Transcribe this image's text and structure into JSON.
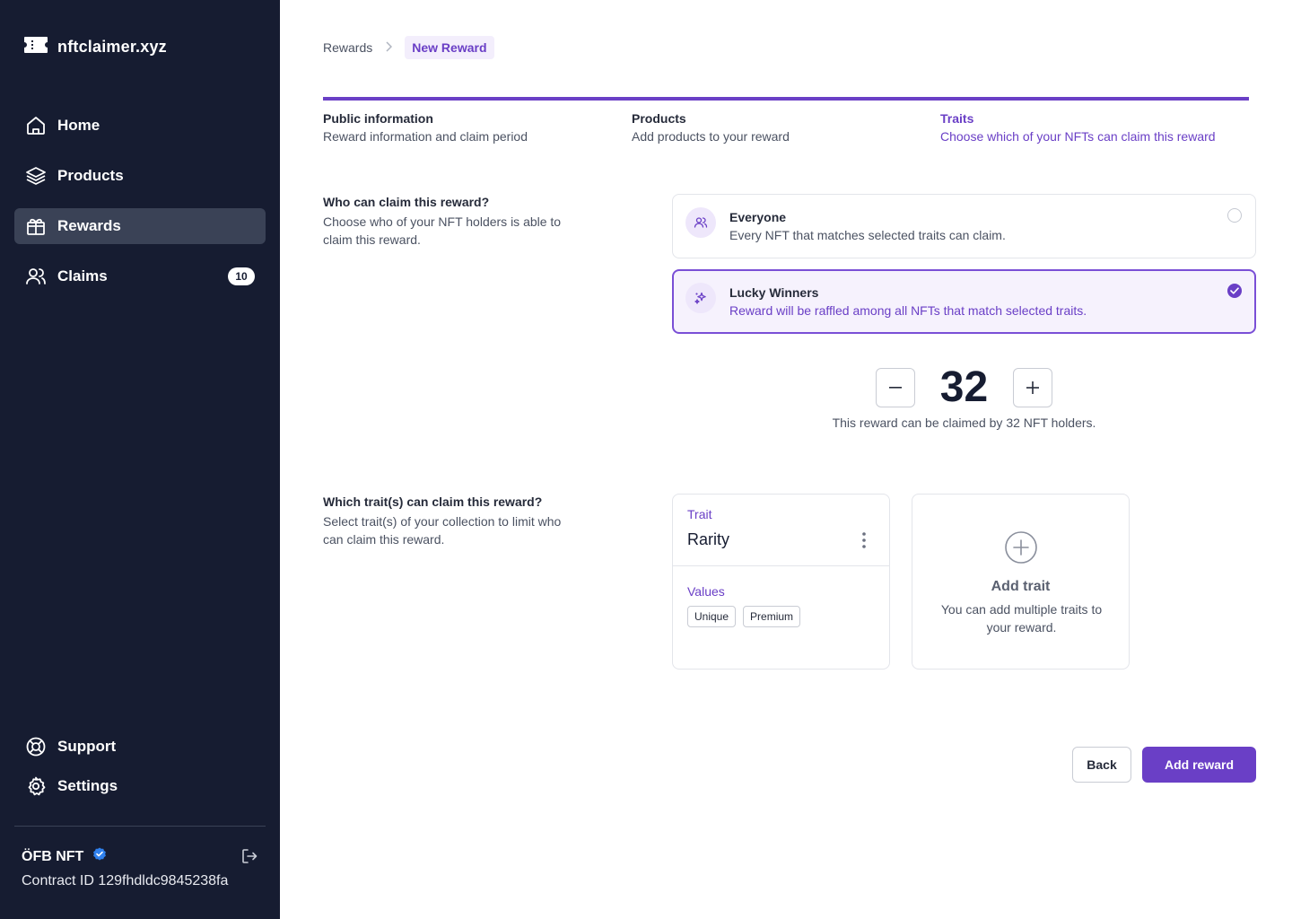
{
  "brand": {
    "name": "nftclaimer.xyz",
    "icon": "ticket-icon"
  },
  "sidebar": {
    "items": [
      {
        "label": "Home",
        "icon": "home-icon"
      },
      {
        "label": "Products",
        "icon": "layers-icon"
      },
      {
        "label": "Rewards",
        "icon": "gift-icon",
        "active": true
      },
      {
        "label": "Claims",
        "icon": "users-icon",
        "badge": "10"
      }
    ],
    "bottom_items": [
      {
        "label": "Support",
        "icon": "lifebuoy-icon"
      },
      {
        "label": "Settings",
        "icon": "gear-icon"
      }
    ],
    "account": {
      "name": "ÖFB NFT",
      "contract": "Contract ID 129fhdldc9845238fa",
      "verified_icon": "verified-badge-icon",
      "logout_icon": "logout-icon"
    }
  },
  "breadcrumb": {
    "parent": "Rewards",
    "current": "New Reward"
  },
  "steps": [
    {
      "title": "Public information",
      "subtitle": "Reward information and claim period"
    },
    {
      "title": "Products",
      "subtitle": "Add products to your reward"
    },
    {
      "title": "Traits",
      "subtitle": "Choose which of your NFTs can claim this reward",
      "active": true
    }
  ],
  "claimers_section": {
    "title": "Who can claim this reward?",
    "description": "Choose who of your NFT holders is able to claim this reward.",
    "options": [
      {
        "title": "Everyone",
        "description": "Every NFT that matches selected traits can claim.",
        "icon": "users-icon",
        "selected": false
      },
      {
        "title": "Lucky Winners",
        "description": "Reward will be raffled among all NFTs that match selected traits.",
        "icon": "sparkles-icon",
        "selected": true
      }
    ],
    "winners_count": "32",
    "winners_note": "This reward can be claimed by 32 NFT holders."
  },
  "traits_section": {
    "title": "Which trait(s) can claim this reward?",
    "description": "Select trait(s) of your collection to limit who can claim this reward.",
    "trait_card": {
      "label": "Trait",
      "name": "Rarity",
      "values_label": "Values",
      "values": [
        "Unique",
        "Premium"
      ]
    },
    "add_card": {
      "title": "Add trait",
      "description": "You can add multiple traits to your reward."
    }
  },
  "actions": {
    "back": "Back",
    "add": "Add reward"
  },
  "colors": {
    "sidebar_bg": "#161c31",
    "accent": "#6a3fc6",
    "active_nav": "#3a4256",
    "verified": "#2f80ed"
  }
}
